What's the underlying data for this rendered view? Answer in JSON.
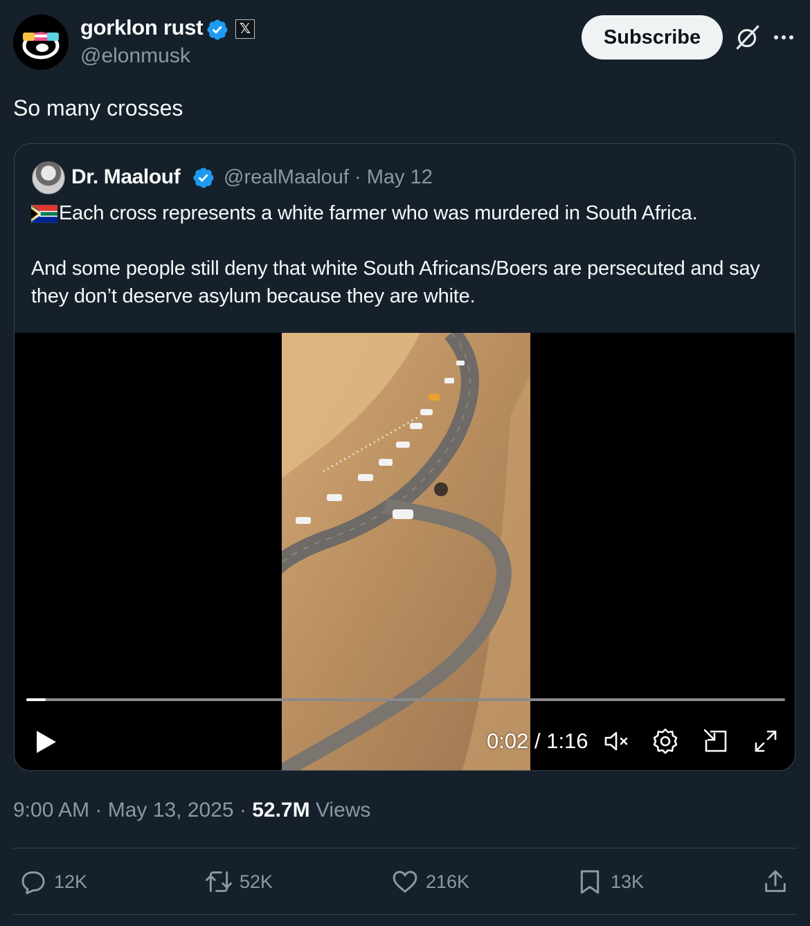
{
  "author": {
    "display_name": "gorklon rust",
    "handle": "@elonmusk",
    "verified_icon": "verified-badge-icon",
    "affiliation_badge": "𝕏"
  },
  "header_actions": {
    "subscribe_label": "Subscribe",
    "grok_icon": "grok-icon",
    "more_icon": "more-icon"
  },
  "tweet": {
    "text": "So many crosses"
  },
  "quoted_tweet": {
    "display_name": "Dr. Maalouf",
    "handle": "@realMaalouf",
    "date": "May 12",
    "flag_icon": "south-africa-flag-icon",
    "paragraph_1": "Each cross represents a white farmer who was murdered in South Africa.",
    "paragraph_2": "And some people still deny that white South Africans/Boers are persecuted and say they don’t deserve asylum because they are white.",
    "video": {
      "current_time": "0:02",
      "duration": "1:16",
      "progress_fraction": 0.026,
      "controls": [
        "play-icon",
        "mute-icon",
        "settings-icon",
        "popout-icon",
        "fullscreen-icon"
      ]
    }
  },
  "meta": {
    "time": "9:00 AM",
    "date": "May 13, 2025",
    "views_count": "52.7M",
    "views_label": "Views"
  },
  "actions": {
    "replies": "12K",
    "reposts": "52K",
    "likes": "216K",
    "bookmarks": "13K"
  },
  "colors": {
    "background": "#15202b",
    "secondary_text": "#8b98a5",
    "verified_blue": "#1d9bf0",
    "border": "#38444d"
  }
}
